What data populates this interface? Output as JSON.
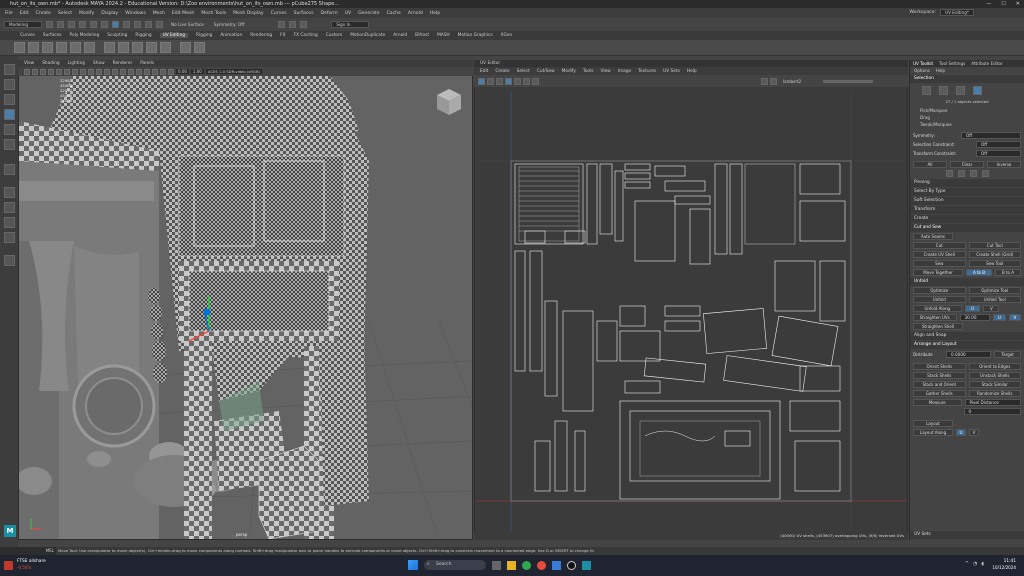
{
  "titlebar": {
    "title": "hut_on_its_own.mb* - Autodesk MAYA 2024.2 - Educational Version: D:\\Zoo environments\\hut_on_its_own.mb   ---   pCube275 Shape..."
  },
  "menubar": {
    "items": [
      "File",
      "Edit",
      "Create",
      "Select",
      "Modify",
      "Display",
      "Windows",
      "Mesh",
      "Edit Mesh",
      "Mesh Tools",
      "Mesh Display",
      "Curves",
      "Surfaces",
      "Deform",
      "UV",
      "Generate",
      "Cache",
      "Arnold",
      "Help"
    ],
    "workspace_label": "Workspace:",
    "workspace_value": "UV Editing*"
  },
  "statusline": {
    "mode": "Modeling",
    "no_live_surface": "No Live Surface",
    "symmetry": "Symmetry: Off",
    "sign_in": "Sign In"
  },
  "shelf_tabs": [
    "Curves",
    "Surfaces",
    "Poly Modeling",
    "Sculpting",
    "Rigging",
    "UV Editing",
    "Rigging",
    "Animation",
    "Rendering",
    "FX",
    "FX Caching",
    "Custom",
    "MotionDuplicate",
    "Arnold",
    "Bifrost",
    "MASH",
    "Motion Graphics",
    "XGen"
  ],
  "shelf_active_index": 5,
  "viewport": {
    "menu": [
      "View",
      "Shading",
      "Lighting",
      "Show",
      "Renderer",
      "Panels"
    ],
    "hud": {
      "verts": "22987",
      "edges": "45468",
      "faces": "22557",
      "tris": "45468",
      "uvs": "24008"
    },
    "exposure": "0.00",
    "gamma": "1.00",
    "colorspace": "ACES 1.0 SDR-video (sRGB)",
    "camera": "persp"
  },
  "uv_editor": {
    "title": "UV Editor",
    "menu": [
      "Edit",
      "Create",
      "Select",
      "Cut/Sew",
      "Modify",
      "Tools",
      "View",
      "Image",
      "Textures",
      "UV Sets",
      "Help"
    ],
    "texture_field": "lambert2",
    "status": "(40000) UV shells, (453907) overlapping UVs, (9/0) reversed UVs"
  },
  "uv_toolkit": {
    "tabs": [
      "UV Toolkit",
      "Tool Settings",
      "Attribute Editor"
    ],
    "menu": [
      "Options",
      "Help"
    ],
    "selection_header": "Selection",
    "selected_count": "27 / 1 objects selected",
    "radio": [
      "Pick/Marquee",
      "Drag",
      "Tweak/Marquee"
    ],
    "symmetry_label": "Symmetry:",
    "symmetry_value": "Off",
    "selection_constraint": "Selection Constraint:",
    "selection_constraint_value": "Off",
    "transform_constraint": "Transform Constraint:",
    "transform_constraint_value": "Off",
    "buttons_row1": [
      "All",
      "Clear",
      "Inverse"
    ],
    "sections_collapsed": [
      "Pinning",
      "Select By Type",
      "Soft Selection",
      "Transform",
      "Create"
    ],
    "cut_sew": "Cut and Sew",
    "auto_seams": "Auto Seams",
    "cut_sew_buttons": [
      "Cut",
      "Cut Tool",
      "Create UV Shell",
      "Create Shell (Grid)",
      "Sew",
      "Sew Tool",
      "Move Together",
      "A to B",
      "B to A"
    ],
    "unfold": "Unfold",
    "unfold_buttons": [
      "Optimize",
      "Optimize Tool",
      "Unfold",
      "Unfold Tool",
      "Unfold Along",
      "U",
      "V",
      "Straighten UVs",
      "30.00",
      "U",
      "V",
      "Straighten Shell"
    ],
    "align_snap": "Align and Snap",
    "arrange_layout": "Arrange and Layout",
    "distribute": "Distribute",
    "distribute_value": "0.0000",
    "target": "Target",
    "arrange_buttons": [
      "Orient Shells",
      "Orient to Edges",
      "Stack Shells",
      "Unstack Shells",
      "Stack and Orient",
      "Stack Similar",
      "Gather Shells",
      "Randomize Shells"
    ],
    "measure": "Measure",
    "measure_value": "Pixel Distance",
    "measure_num": "0",
    "layout": "Layout",
    "layout_along": "Layout Along",
    "layout_u": "U",
    "layout_v": "V",
    "uv_sets": "UV Sets"
  },
  "helpline": "Move Tool: Use manipulator to move object(s). Ctrl+middle-drag to move components along normals. Shift+drag manipulator axis or plane handles to extrude components or clone objects. Ctrl+Shift+drag to constrain movement to a connected edge. Use D or INSERT to change th",
  "cmdline": "MEL",
  "taskbar": {
    "stock_name": "FTSE allshare",
    "stock_change": "-0.56%",
    "search": "Search",
    "time": "11:41",
    "date": "10/12/2024"
  },
  "colors": {
    "accent": "#4a7ea8",
    "viewport_bg": "#636363",
    "uv_bg": "#3b3b3b"
  }
}
